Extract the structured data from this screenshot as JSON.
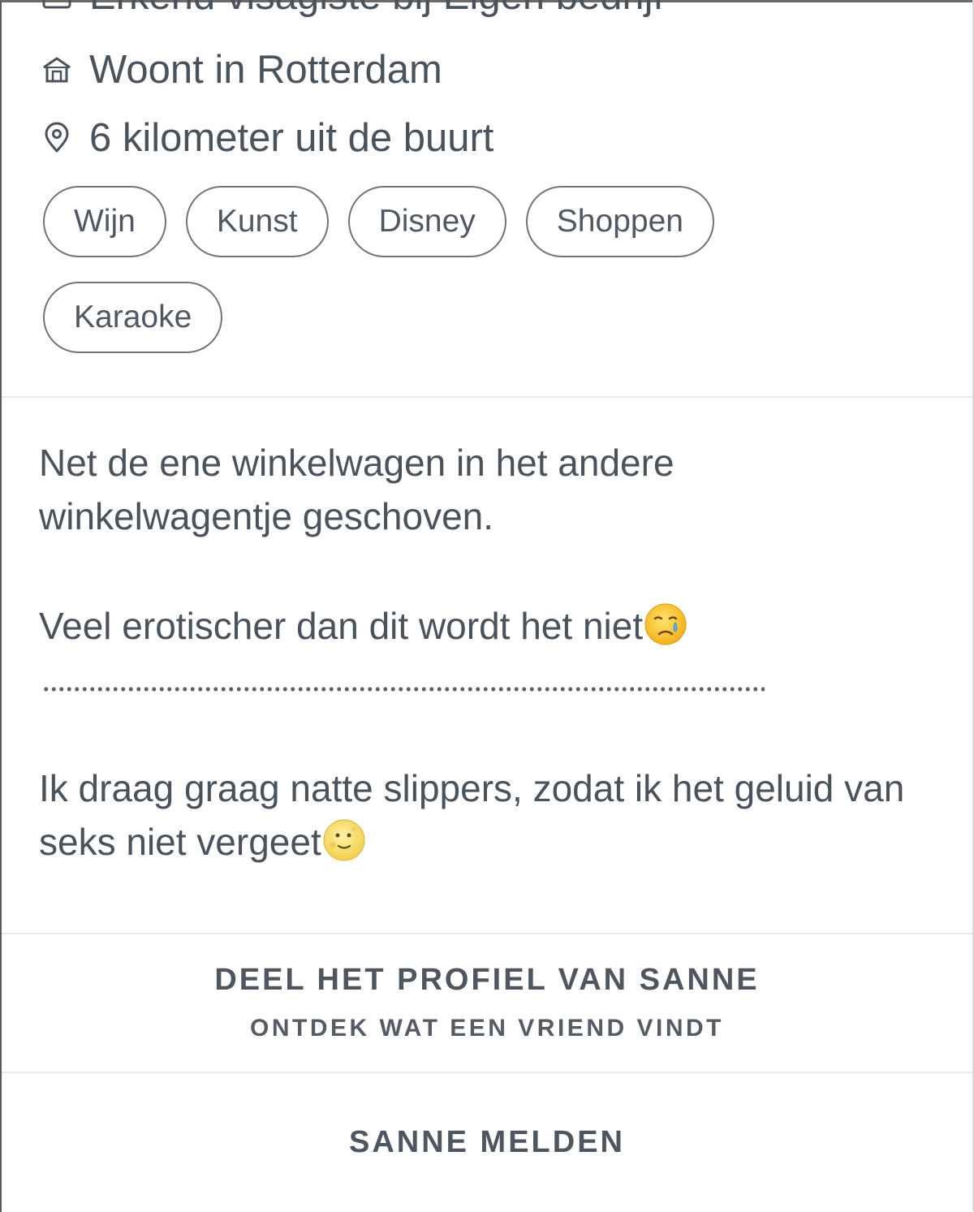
{
  "profile": {
    "job": "Erkend visagiste bij Eigen bedrijf",
    "lives": "Woont in Rotterdam",
    "distance": "6 kilometer uit de buurt",
    "interests": [
      "Wijn",
      "Kunst",
      "Disney",
      "Shoppen",
      "Karaoke"
    ],
    "bio": {
      "line1": "Net de ene winkelwagen in het andere winkelwagentje geschoven.",
      "line2": "Veel erotischer dan dit wordt het niet",
      "line3": "Ik draag graag natte slippers, zodat ik het geluid van seks niet vergeet"
    }
  },
  "icons": {
    "job": "briefcase-icon",
    "lives": "house-icon",
    "distance": "location-pin-icon",
    "emoji1": "smiling-face-with-tear-emoji",
    "emoji2": "full-moon-face-emoji"
  },
  "actions": {
    "share_title": "DEEL HET PROFIEL VAN SANNE",
    "share_subtitle": "ONTDEK WAT EEN VRIEND VINDT",
    "report": "SANNE MELDEN"
  }
}
